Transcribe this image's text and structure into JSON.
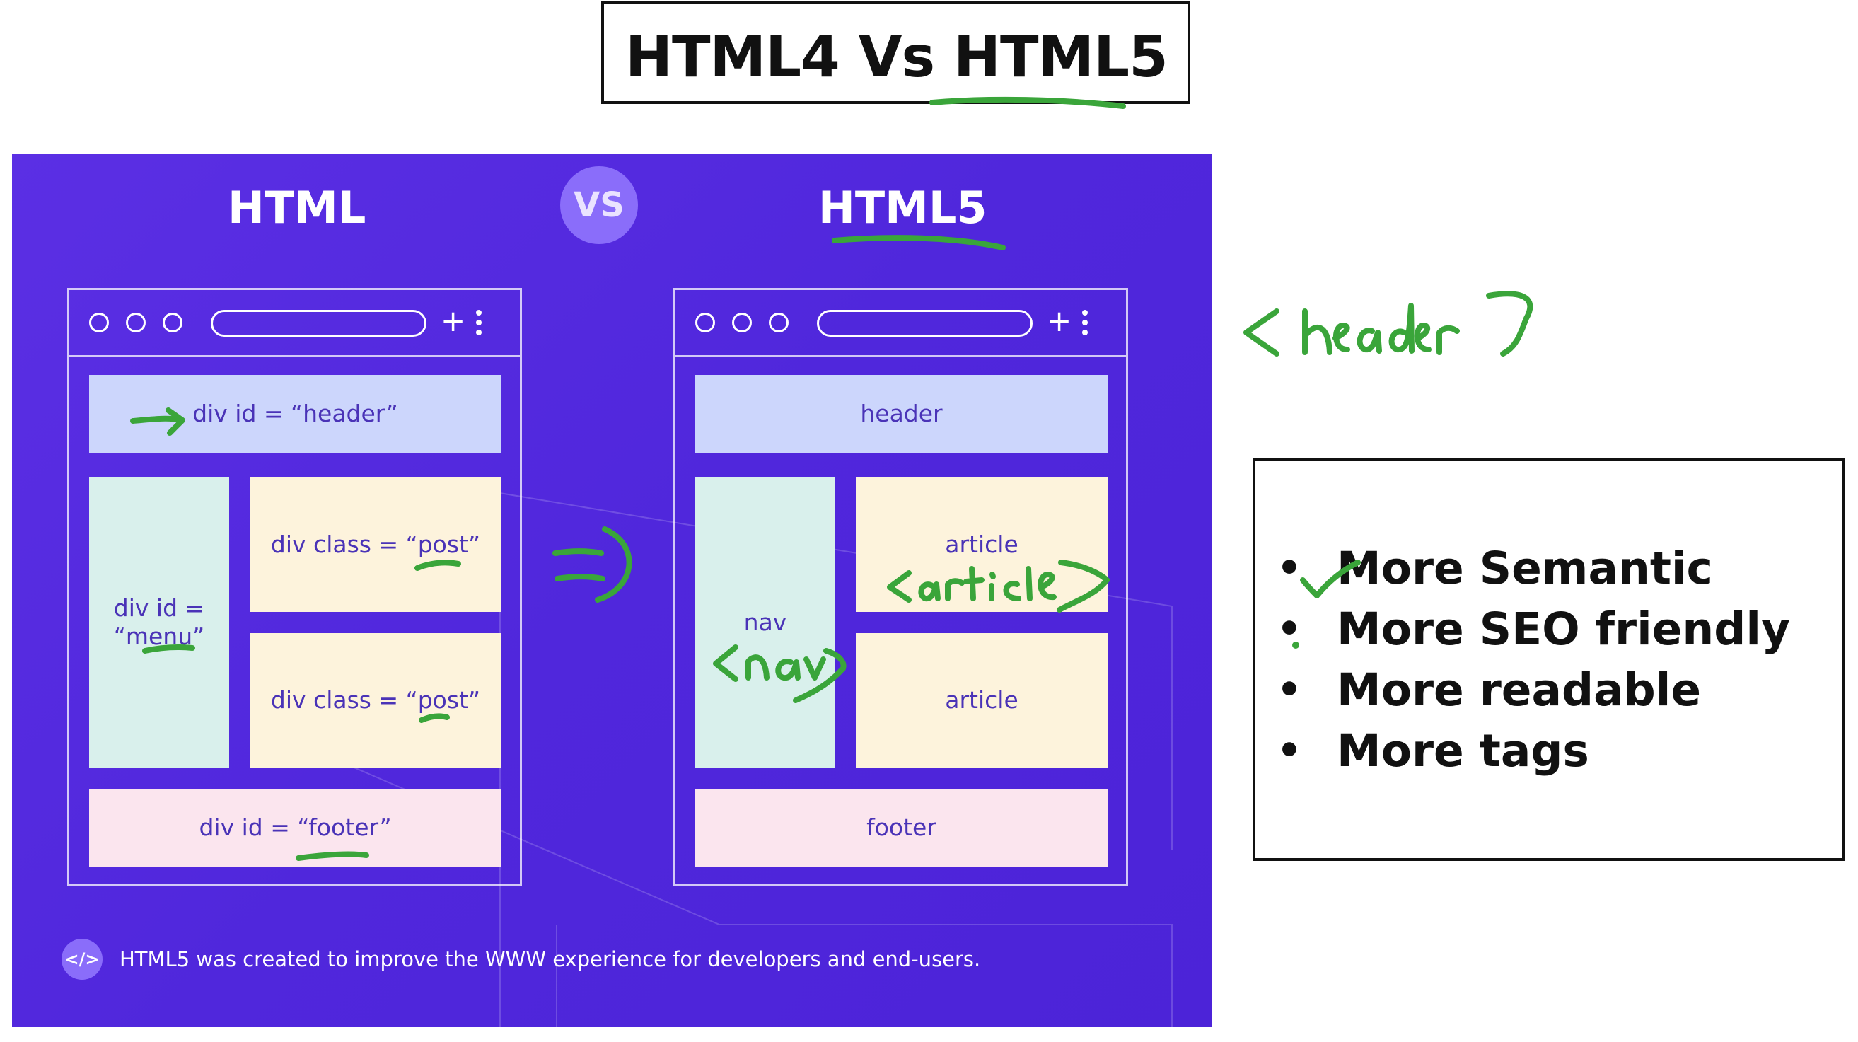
{
  "title": {
    "left": "HTML4 Vs ",
    "right": "HTML5"
  },
  "slide": {
    "left_title": "HTML",
    "vs": "VS",
    "right_title": "HTML5",
    "left_browser": {
      "header": "div id = “header”",
      "menu_line1": "div id =",
      "menu_line2": "“menu”",
      "post1": "div class = “post”",
      "post2": "div class = “post”",
      "footer": "div id = “footer”"
    },
    "right_browser": {
      "header": "header",
      "nav": "nav",
      "article1": "article",
      "article2": "article",
      "footer": "footer"
    },
    "caption_icon": "</>",
    "caption": "HTML5 was created to improve the WWW experience for developers and end-users."
  },
  "benefits": [
    "More Semantic",
    "More SEO friendly",
    "More readable",
    "More tags"
  ],
  "annotations": {
    "header_tag": "<header>",
    "article_tag": "<article>",
    "nav_tag": "<nav>",
    "arrow": "=>"
  },
  "colors": {
    "slide_bg": "#5027dc",
    "vs_badge": "#8a6dfa",
    "header_block": "#ccd6fc",
    "menu_block": "#d9f0ec",
    "post_block": "#fdf3dc",
    "footer_block": "#fbe5ee",
    "block_text": "#4a33b7",
    "ink": "#3aa53a"
  }
}
